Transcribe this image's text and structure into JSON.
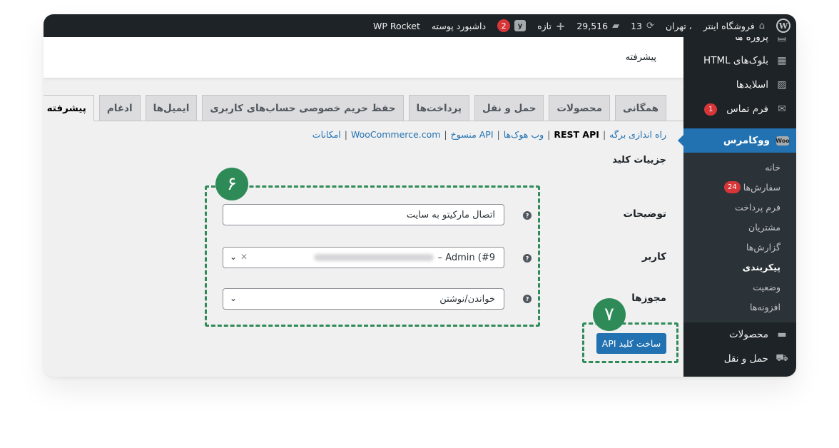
{
  "adminbar": {
    "site_name": "فروشگاه اینتر",
    "location_text": "، تهران",
    "updates_count": "13",
    "comments_count": "29,516",
    "new_label": "تازه",
    "notifications_count": "2",
    "dashboard_label": "داشبورد پوسته",
    "wp_rocket_label": "WP Rocket"
  },
  "sidebar": {
    "partial_item": "پروژه ها",
    "items": [
      {
        "label": "بلوک‌های HTML",
        "icon": "grid-icon"
      },
      {
        "label": "اسلایدها",
        "icon": "image-icon"
      },
      {
        "label": "فرم تماس",
        "icon": "mail-icon",
        "count": "1"
      }
    ],
    "active_item": {
      "label": "ووکامرس",
      "icon": "woo-icon",
      "icon_text": "Woo"
    },
    "submenu": [
      {
        "label": "خانه"
      },
      {
        "label": "سفارش‌ها",
        "count": "24"
      },
      {
        "label": "فرم پرداخت"
      },
      {
        "label": "مشتریان"
      },
      {
        "label": "گزارش‌ها"
      },
      {
        "label": "پیکربندی",
        "current": true
      },
      {
        "label": "وضعیت"
      },
      {
        "label": "افزونه‌ها"
      }
    ],
    "after_items": [
      {
        "label": "محصولات",
        "icon": "archive-icon"
      },
      {
        "label": "حمل و نقل",
        "icon": "truck-icon"
      }
    ]
  },
  "header": {
    "title": "پیشرفته"
  },
  "tabs": [
    {
      "label": "همگانی"
    },
    {
      "label": "محصولات"
    },
    {
      "label": "حمل و نقل"
    },
    {
      "label": "پرداخت‌ها"
    },
    {
      "label": "حفظ حریم خصوصی حساب‌های کاربری"
    },
    {
      "label": "ایمیل‌ها"
    },
    {
      "label": "ادغام"
    },
    {
      "label": "پیشرفته",
      "active": true
    }
  ],
  "subsub": {
    "page_setup": "راه اندازی برگه",
    "rest_api": "REST API",
    "webhooks": "وب هوک‌ها",
    "legacy_api": "API منسوخ",
    "woocommerce_com": "WooCommerce.com",
    "features": "امکانات",
    "separator": "|"
  },
  "form": {
    "section_title": "جزییات کلید",
    "description_label": "توضیحات",
    "description_value": "اتصال مارکیتو به سایت",
    "user_label": "کاربر",
    "user_value": "Admin (#9 –",
    "permissions_label": "مجوزها",
    "permissions_value": "خواندن/نوشتن",
    "generate_button": "ساخت کلید API",
    "help_glyph": "?"
  },
  "annotations": {
    "step6": "۶",
    "step7": "۷",
    "accent_color": "#2e8b57"
  },
  "colors": {
    "primary": "#2271b1",
    "adminbar": "#1d2327",
    "badge": "#d63638"
  }
}
